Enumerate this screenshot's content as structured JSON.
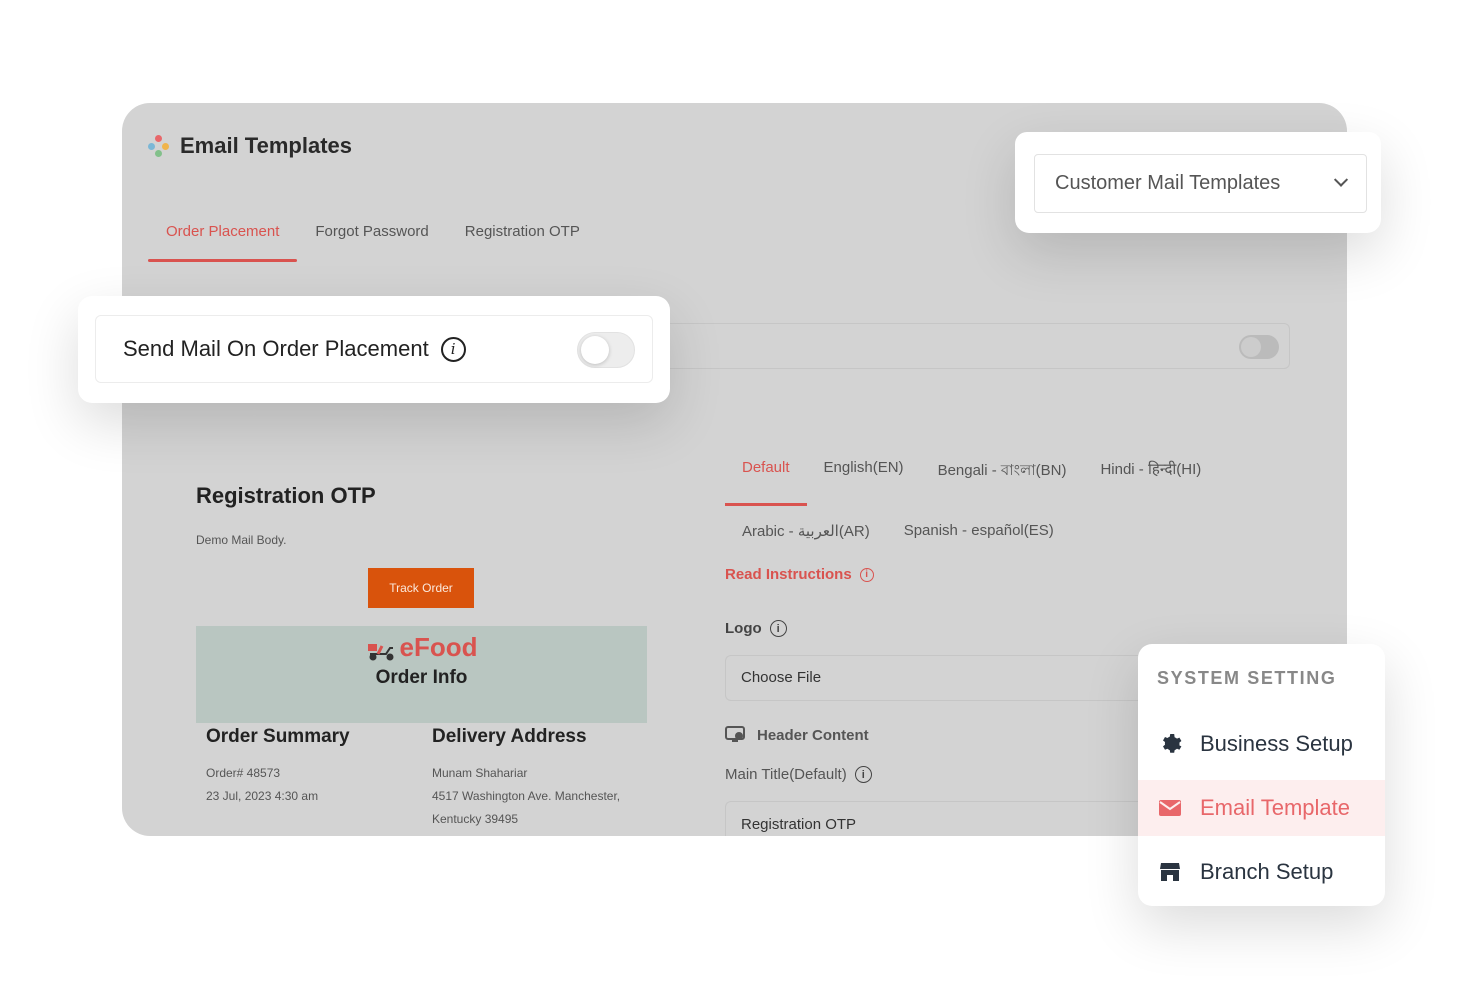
{
  "app": {
    "title": "Email Templates",
    "tabs": [
      {
        "label": "Order Placement",
        "active": true
      },
      {
        "label": "Forgot Password",
        "active": false
      },
      {
        "label": "Registration OTP",
        "active": false
      }
    ]
  },
  "preview": {
    "title": "Registration OTP",
    "body": "Demo Mail Body.",
    "button": "Track Order",
    "brand": "eFood",
    "order_info": "Order Info",
    "summary": {
      "heading": "Order Summary",
      "order_no": "Order# 48573",
      "date": "23 Jul, 2023 4:30 am"
    },
    "delivery": {
      "heading": "Delivery Address",
      "name": "Munam Shahariar",
      "line1": "4517 Washington Ave. Manchester,",
      "line2": "Kentucky 39495"
    }
  },
  "languages": {
    "row1": [
      "Default",
      "English(EN)",
      "Bengali - বাংলা(BN)",
      "Hindi - हिन्दी(HI)"
    ],
    "row2": [
      "Arabic - العربية(AR)",
      "Spanish - español(ES)"
    ],
    "active": "Default"
  },
  "form": {
    "read_instructions": "Read Instructions",
    "logo_label": "Logo",
    "choose_file": "Choose File",
    "header_content": "Header Content",
    "main_title_label": "Main Title(Default)",
    "main_title_value": "Registration OTP"
  },
  "send_card": {
    "label": "Send Mail On Order Placement",
    "toggle_on": false
  },
  "mail_select": {
    "value": "Customer Mail Templates"
  },
  "system_setting": {
    "heading": "SYSTEM SETTING",
    "items": [
      {
        "label": "Business Setup",
        "icon": "gear-icon",
        "active": false
      },
      {
        "label": "Email Template",
        "icon": "envelope-icon",
        "active": true
      },
      {
        "label": "Branch Setup",
        "icon": "store-icon",
        "active": false
      }
    ]
  },
  "colors": {
    "accent": "#d9534f",
    "button": "#d9530c"
  }
}
